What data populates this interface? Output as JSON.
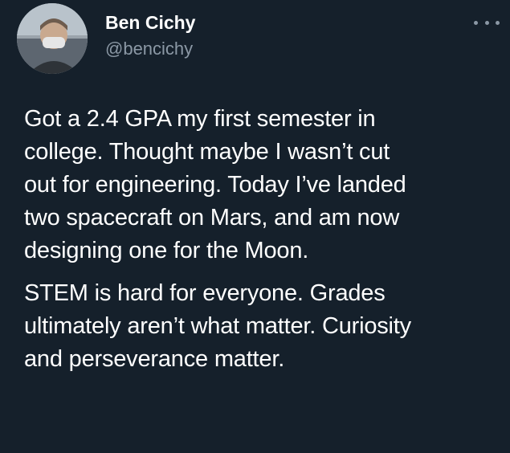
{
  "tweet": {
    "author": {
      "name": "Ben Cichy",
      "handle": "@bencichy",
      "avatar_icon": "user-avatar-photo"
    },
    "more_icon": "more-options-icon",
    "paragraphs": [
      {
        "lines": [
          "Got a 2.4 GPA my first semester in",
          "college. Thought maybe I wasn’t cut",
          "out for engineering. Today I’ve landed",
          "two spacecraft on Mars, and am now",
          "designing one for the Moon."
        ]
      },
      {
        "lines": [
          "STEM is hard for everyone. Grades",
          "ultimately aren’t what matter.  Curiosity",
          "and perseverance matter."
        ]
      }
    ]
  },
  "colors": {
    "background": "#15202b",
    "text": "#ffffff",
    "secondary": "#8b98a5"
  }
}
